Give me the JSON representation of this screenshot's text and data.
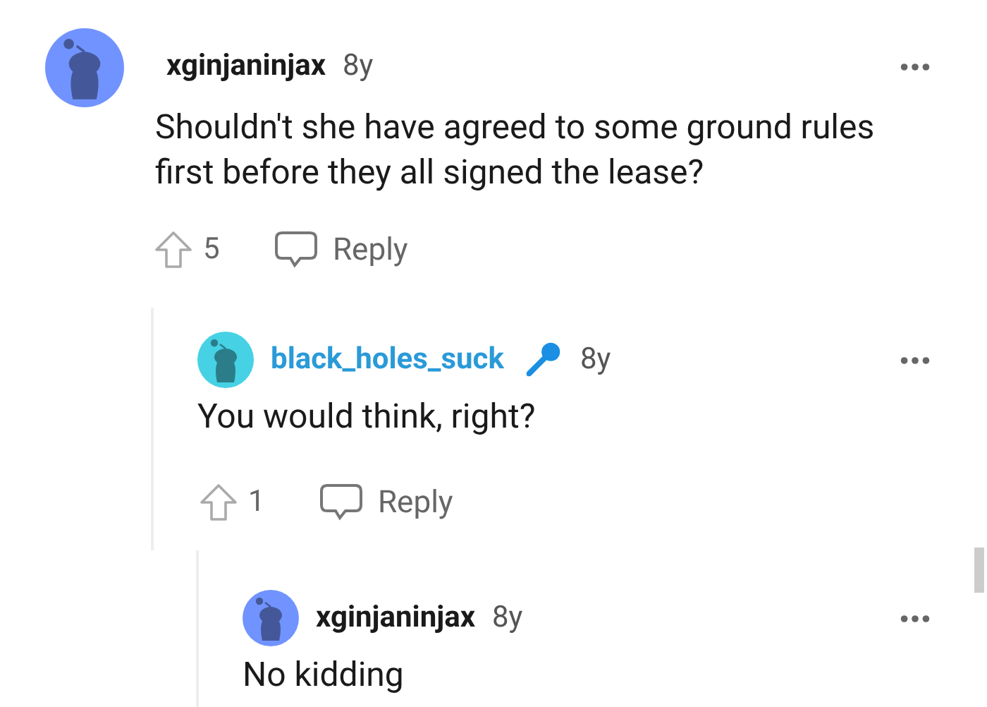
{
  "comments": [
    {
      "author": "xginjaninjax",
      "age": "8y",
      "op": false,
      "color": "#7193ff",
      "body": "Shouldn't she have agreed to some ground rules first before they all signed the lease?",
      "score": "5",
      "reply": "Reply",
      "children": [
        {
          "author": "black_holes_suck",
          "age": "8y",
          "op": true,
          "color": "#46d1e5",
          "body": "You would think, right?",
          "score": "1",
          "reply": "Reply",
          "children": [
            {
              "author": "xginjaninjax",
              "age": "8y",
              "op": false,
              "color": "#7193ff",
              "body": "No kidding"
            }
          ]
        }
      ]
    }
  ]
}
